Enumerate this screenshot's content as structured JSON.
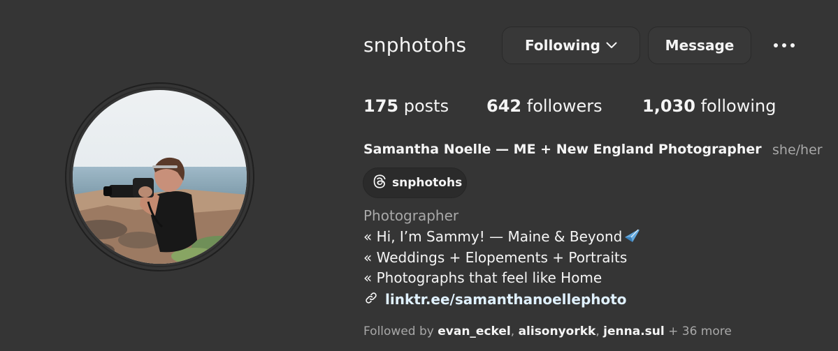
{
  "profile": {
    "username": "snphotohs",
    "following_button": "Following",
    "message_button": "Message",
    "stats": {
      "posts_count": "175",
      "posts_label": "posts",
      "followers_count": "642",
      "followers_label": "followers",
      "following_count": "1,030",
      "following_label": "following"
    },
    "full_name": "Samantha Noelle — ME + New England Photographer",
    "pronouns": "she/her",
    "threads_handle": "snphotohs",
    "category": "Photographer",
    "bio_lines": [
      "« Hi, I’m Sammy! — Maine & Beyond",
      "« Weddings + Elopements + Portraits",
      "« Photographs that feel like Home"
    ],
    "link": "linktr.ee/samanthanoellephoto",
    "followed_by": {
      "prefix": "Followed by",
      "users": [
        "evan_eckel",
        "alisonyorkk",
        "jenna.sul"
      ],
      "suffix": "+ 36 more"
    }
  },
  "icons": {
    "chevron": "chevron-down-icon",
    "more": "more-options-icon",
    "threads": "threads-icon",
    "link": "link-icon",
    "plane": "airplane-emoji"
  },
  "colors": {
    "background": "#353535",
    "button": "#383838",
    "text": "#f5f5f5",
    "muted": "#a8a8a8",
    "link": "#e0f1ff"
  }
}
